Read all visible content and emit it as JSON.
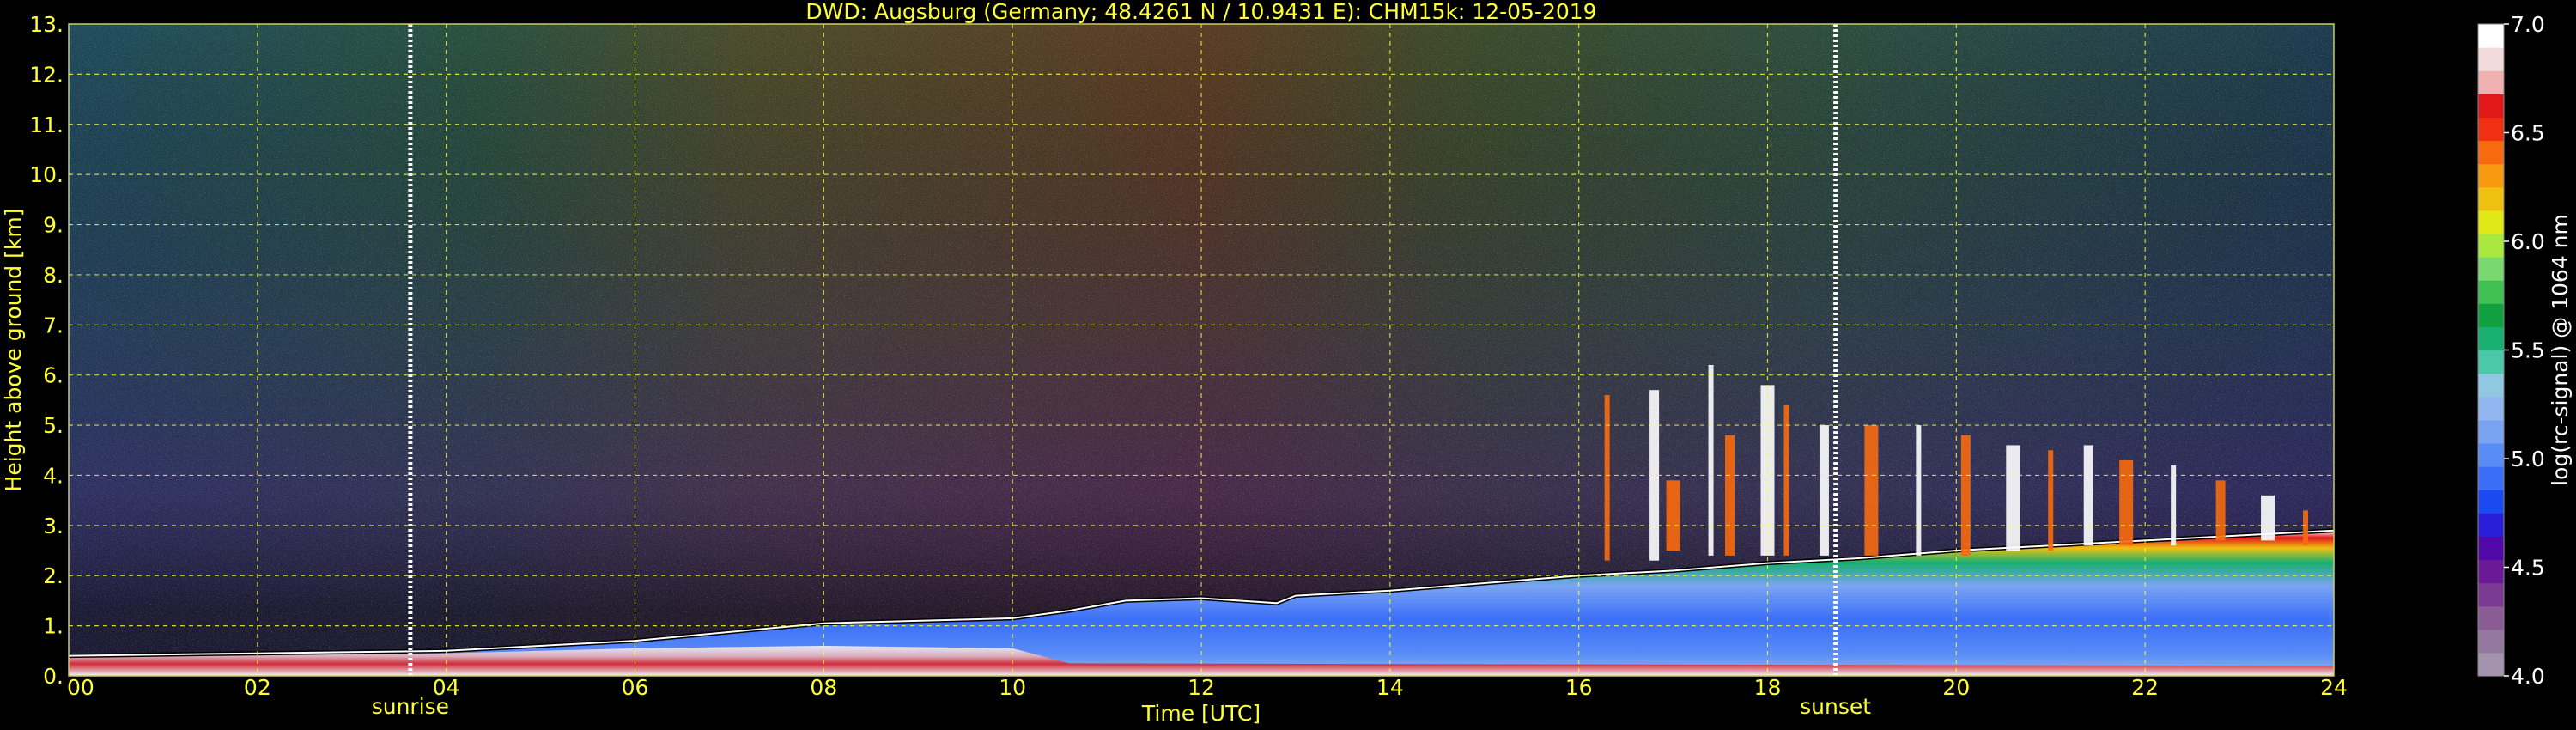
{
  "chart_data": {
    "type": "heatmap",
    "title": "DWD: Augsburg (Germany; 48.4261 N / 10.9431 E):    CHM15k: 12-05-2019",
    "xlabel": "Time [UTC]",
    "ylabel": "Height above ground [km]",
    "xlim": [
      0,
      24
    ],
    "ylim": [
      0,
      13
    ],
    "x_ticks": [
      "00",
      "02",
      "04",
      "06",
      "08",
      "10",
      "12",
      "14",
      "16",
      "18",
      "20",
      "22",
      "24"
    ],
    "y_ticks": [
      "0.",
      "1.",
      "2.",
      "3.",
      "4.",
      "5.",
      "6.",
      "7.",
      "8.",
      "9.",
      "10.",
      "11.",
      "12.",
      "13."
    ],
    "grid": true,
    "events": [
      {
        "label": "sunrise",
        "time": 3.62
      },
      {
        "label": "sunset",
        "time": 18.72
      }
    ],
    "boundary_layer_top": [
      [
        0.0,
        0.4
      ],
      [
        2.0,
        0.45
      ],
      [
        4.0,
        0.5
      ],
      [
        6.0,
        0.7
      ],
      [
        8.0,
        1.05
      ],
      [
        10.0,
        1.15
      ],
      [
        10.6,
        1.3
      ],
      [
        11.2,
        1.5
      ],
      [
        12.0,
        1.55
      ],
      [
        12.8,
        1.45
      ],
      [
        13.0,
        1.6
      ],
      [
        14.0,
        1.7
      ],
      [
        15.0,
        1.85
      ],
      [
        16.0,
        2.0
      ],
      [
        17.0,
        2.1
      ],
      [
        18.0,
        2.25
      ],
      [
        19.0,
        2.35
      ],
      [
        20.0,
        2.5
      ],
      [
        21.0,
        2.6
      ],
      [
        22.0,
        2.7
      ],
      [
        23.0,
        2.8
      ],
      [
        24.0,
        2.9
      ]
    ],
    "colorbar": {
      "label": "log(rc-signal) @ 1064 nm",
      "min": 4.0,
      "max": 7.0,
      "tick_labels": [
        "4.0",
        "4.5",
        "5.0",
        "5.5",
        "6.0",
        "6.5",
        "7.0"
      ],
      "colors": [
        "#a393ac",
        "#93779e",
        "#8a5c96",
        "#7a3a94",
        "#6a1a96",
        "#5008a8",
        "#2a1ed8",
        "#1a4af0",
        "#3a6ef8",
        "#5a8cf6",
        "#7aa4f2",
        "#92b6f0",
        "#8fc8e0",
        "#4bc8a8",
        "#18b070",
        "#10a040",
        "#40c050",
        "#7ad870",
        "#a8e840",
        "#e0e818",
        "#f0c010",
        "#f89a10",
        "#f86a10",
        "#f03010",
        "#e01818",
        "#f0b0b0",
        "#f0dada",
        "#ffffff"
      ]
    }
  }
}
